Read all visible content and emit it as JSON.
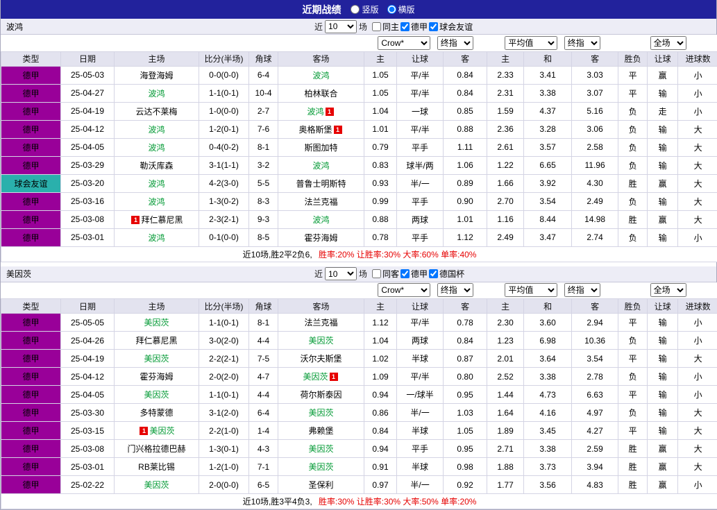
{
  "topbar": {
    "title": "近期战绩",
    "modes": [
      {
        "label": "竖版",
        "selected": false
      },
      {
        "label": "横版",
        "selected": true
      }
    ]
  },
  "headers": [
    "类型",
    "日期",
    "主场",
    "比分(半场)",
    "角球",
    "客场",
    "主",
    "让球",
    "客",
    "主",
    "和",
    "客",
    "胜负",
    "让球",
    "进球数"
  ],
  "select_row": {
    "asia": [
      "Crow*",
      "终指"
    ],
    "euro": [
      "平均值",
      "终指"
    ],
    "scope": [
      "全场"
    ]
  },
  "colors": {
    "topbar": "#22229c",
    "league_badge": "#990099",
    "friendly_badge": "#2ab0ac",
    "win": "#e60000",
    "draw": "#009933",
    "loss": "#1a1ad9",
    "team_highlight": "#009933",
    "score": "#d10000"
  },
  "sections": [
    {
      "team": "波鸿",
      "filters": {
        "recent_label": "近",
        "recent_value": "10",
        "recent_suffix": "场",
        "checkboxes": [
          {
            "label": "同主",
            "checked": false
          },
          {
            "label": "德甲",
            "checked": true
          },
          {
            "label": "球会友谊",
            "checked": true
          }
        ]
      },
      "rows": [
        {
          "type": "德甲",
          "style": "purple",
          "date": "25-05-03",
          "home": {
            "name": "海登海姆",
            "green": false
          },
          "score": "0-0(0-0)",
          "corner": "6-4",
          "away": {
            "name": "波鸿",
            "green": true
          },
          "asia": [
            "1.05",
            "平/半",
            "0.84"
          ],
          "euro": [
            "2.33",
            "3.41",
            "3.03"
          ],
          "res": [
            "平",
            "green"
          ],
          "let": [
            "赢",
            "red"
          ],
          "goal": [
            "小",
            "green"
          ]
        },
        {
          "type": "德甲",
          "style": "purple",
          "date": "25-04-27",
          "home": {
            "name": "波鸿",
            "green": true
          },
          "score": "1-1(0-1)",
          "corner": "10-4",
          "away": {
            "name": "柏林联合",
            "green": false
          },
          "asia": [
            "1.05",
            "平/半",
            "0.84"
          ],
          "euro": [
            "2.31",
            "3.38",
            "3.07"
          ],
          "res": [
            "平",
            "green"
          ],
          "let": [
            "输",
            "blue"
          ],
          "goal": [
            "小",
            "green"
          ]
        },
        {
          "type": "德甲",
          "style": "purple",
          "date": "25-04-19",
          "home": {
            "name": "云达不莱梅",
            "green": false
          },
          "score": "1-0(0-0)",
          "corner": "2-7",
          "away": {
            "name": "波鸿",
            "green": true,
            "card": "after"
          },
          "asia": [
            "1.04",
            "一球",
            "0.85"
          ],
          "euro": [
            "1.59",
            "4.37",
            "5.16"
          ],
          "res": [
            "负",
            "blue"
          ],
          "let": [
            "走",
            "green"
          ],
          "goal": [
            "小",
            "green"
          ]
        },
        {
          "type": "德甲",
          "style": "purple",
          "date": "25-04-12",
          "home": {
            "name": "波鸿",
            "green": true
          },
          "score": "1-2(0-1)",
          "corner": "7-6",
          "away": {
            "name": "奥格斯堡",
            "green": false,
            "card": "after"
          },
          "asia": [
            "1.01",
            "平/半",
            "0.88"
          ],
          "euro": [
            "2.36",
            "3.28",
            "3.06"
          ],
          "res": [
            "负",
            "blue"
          ],
          "let": [
            "输",
            "blue"
          ],
          "goal": [
            "大",
            "red"
          ]
        },
        {
          "type": "德甲",
          "style": "purple",
          "date": "25-04-05",
          "home": {
            "name": "波鸿",
            "green": true
          },
          "score": "0-4(0-2)",
          "corner": "8-1",
          "away": {
            "name": "斯图加特",
            "green": false
          },
          "asia": [
            "0.79",
            "平手",
            "1.11"
          ],
          "euro": [
            "2.61",
            "3.57",
            "2.58"
          ],
          "res": [
            "负",
            "blue"
          ],
          "let": [
            "输",
            "blue"
          ],
          "goal": [
            "大",
            "red"
          ]
        },
        {
          "type": "德甲",
          "style": "purple",
          "date": "25-03-29",
          "home": {
            "name": "勒沃库森",
            "green": false
          },
          "score": "3-1(1-1)",
          "corner": "3-2",
          "away": {
            "name": "波鸿",
            "green": true
          },
          "asia": [
            "0.83",
            "球半/两",
            "1.06"
          ],
          "euro": [
            "1.22",
            "6.65",
            "11.96"
          ],
          "res": [
            "负",
            "blue"
          ],
          "let": [
            "输",
            "blue"
          ],
          "goal": [
            "大",
            "red"
          ]
        },
        {
          "type": "球会友谊",
          "style": "teal",
          "date": "25-03-20",
          "home": {
            "name": "波鸿",
            "green": true
          },
          "score": "4-2(3-0)",
          "corner": "5-5",
          "away": {
            "name": "普鲁士明斯特",
            "green": false
          },
          "asia": [
            "0.93",
            "半/一",
            "0.89"
          ],
          "euro": [
            "1.66",
            "3.92",
            "4.30"
          ],
          "res": [
            "胜",
            "red"
          ],
          "let": [
            "赢",
            "red"
          ],
          "goal": [
            "大",
            "red"
          ]
        },
        {
          "type": "德甲",
          "style": "purple",
          "date": "25-03-16",
          "home": {
            "name": "波鸿",
            "green": true
          },
          "score": "1-3(0-2)",
          "corner": "8-3",
          "away": {
            "name": "法兰克福",
            "green": false
          },
          "asia": [
            "0.99",
            "平手",
            "0.90"
          ],
          "euro": [
            "2.70",
            "3.54",
            "2.49"
          ],
          "res": [
            "负",
            "blue"
          ],
          "let": [
            "输",
            "blue"
          ],
          "goal": [
            "大",
            "red"
          ]
        },
        {
          "type": "德甲",
          "style": "purple",
          "date": "25-03-08",
          "home": {
            "name": "拜仁慕尼黑",
            "green": false,
            "card": "before"
          },
          "score": "2-3(2-1)",
          "corner": "9-3",
          "away": {
            "name": "波鸿",
            "green": true
          },
          "asia": [
            "0.88",
            "两球",
            "1.01"
          ],
          "euro": [
            "1.16",
            "8.44",
            "14.98"
          ],
          "res": [
            "胜",
            "red"
          ],
          "let": [
            "赢",
            "red"
          ],
          "goal": [
            "大",
            "red"
          ]
        },
        {
          "type": "德甲",
          "style": "purple",
          "date": "25-03-01",
          "home": {
            "name": "波鸿",
            "green": true
          },
          "score": "0-1(0-0)",
          "corner": "8-5",
          "away": {
            "name": "霍芬海姆",
            "green": false
          },
          "asia": [
            "0.78",
            "平手",
            "1.12"
          ],
          "euro": [
            "2.49",
            "3.47",
            "2.74"
          ],
          "res": [
            "负",
            "blue"
          ],
          "let": [
            "输",
            "blue"
          ],
          "goal": [
            "小",
            "green"
          ]
        }
      ],
      "footer": {
        "prefix": "近10场,胜2平2负6,",
        "stats": "胜率:20% 让胜率:30% 大率:60% 单率:40%"
      }
    },
    {
      "team": "美因茨",
      "filters": {
        "recent_label": "近",
        "recent_value": "10",
        "recent_suffix": "场",
        "checkboxes": [
          {
            "label": "同客",
            "checked": false
          },
          {
            "label": "德甲",
            "checked": true
          },
          {
            "label": "德国杯",
            "checked": true
          }
        ]
      },
      "rows": [
        {
          "type": "德甲",
          "style": "purple",
          "date": "25-05-05",
          "home": {
            "name": "美因茨",
            "green": true
          },
          "score": "1-1(0-1)",
          "corner": "8-1",
          "away": {
            "name": "法兰克福",
            "green": false
          },
          "asia": [
            "1.12",
            "平/半",
            "0.78"
          ],
          "euro": [
            "2.30",
            "3.60",
            "2.94"
          ],
          "res": [
            "平",
            "green"
          ],
          "let": [
            "输",
            "blue"
          ],
          "goal": [
            "小",
            "green"
          ]
        },
        {
          "type": "德甲",
          "style": "purple",
          "date": "25-04-26",
          "home": {
            "name": "拜仁慕尼黑",
            "green": false
          },
          "score": "3-0(2-0)",
          "corner": "4-4",
          "away": {
            "name": "美因茨",
            "green": true
          },
          "asia": [
            "1.04",
            "两球",
            "0.84"
          ],
          "euro": [
            "1.23",
            "6.98",
            "10.36"
          ],
          "res": [
            "负",
            "blue"
          ],
          "let": [
            "输",
            "blue"
          ],
          "goal": [
            "小",
            "green"
          ]
        },
        {
          "type": "德甲",
          "style": "purple",
          "date": "25-04-19",
          "home": {
            "name": "美因茨",
            "green": true
          },
          "score": "2-2(2-1)",
          "corner": "7-5",
          "away": {
            "name": "沃尔夫斯堡",
            "green": false
          },
          "asia": [
            "1.02",
            "半球",
            "0.87"
          ],
          "euro": [
            "2.01",
            "3.64",
            "3.54"
          ],
          "res": [
            "平",
            "green"
          ],
          "let": [
            "输",
            "blue"
          ],
          "goal": [
            "大",
            "red"
          ]
        },
        {
          "type": "德甲",
          "style": "purple",
          "date": "25-04-12",
          "home": {
            "name": "霍芬海姆",
            "green": false
          },
          "score": "2-0(2-0)",
          "corner": "4-7",
          "away": {
            "name": "美因茨",
            "green": true,
            "card": "after"
          },
          "asia": [
            "1.09",
            "平/半",
            "0.80"
          ],
          "euro": [
            "2.52",
            "3.38",
            "2.78"
          ],
          "res": [
            "负",
            "blue"
          ],
          "let": [
            "输",
            "blue"
          ],
          "goal": [
            "小",
            "green"
          ]
        },
        {
          "type": "德甲",
          "style": "purple",
          "date": "25-04-05",
          "home": {
            "name": "美因茨",
            "green": true
          },
          "score": "1-1(0-1)",
          "corner": "4-4",
          "away": {
            "name": "荷尔斯泰因",
            "green": false
          },
          "asia": [
            "0.94",
            "一/球半",
            "0.95"
          ],
          "euro": [
            "1.44",
            "4.73",
            "6.63"
          ],
          "res": [
            "平",
            "green"
          ],
          "let": [
            "输",
            "blue"
          ],
          "goal": [
            "小",
            "green"
          ]
        },
        {
          "type": "德甲",
          "style": "purple",
          "date": "25-03-30",
          "home": {
            "name": "多特蒙德",
            "green": false
          },
          "score": "3-1(2-0)",
          "corner": "6-4",
          "away": {
            "name": "美因茨",
            "green": true
          },
          "asia": [
            "0.86",
            "半/一",
            "1.03"
          ],
          "euro": [
            "1.64",
            "4.16",
            "4.97"
          ],
          "res": [
            "负",
            "blue"
          ],
          "let": [
            "输",
            "blue"
          ],
          "goal": [
            "大",
            "red"
          ]
        },
        {
          "type": "德甲",
          "style": "purple",
          "date": "25-03-15",
          "home": {
            "name": "美因茨",
            "green": true,
            "card": "before"
          },
          "score": "2-2(1-0)",
          "corner": "1-4",
          "away": {
            "name": "弗赖堡",
            "green": false
          },
          "asia": [
            "0.84",
            "半球",
            "1.05"
          ],
          "euro": [
            "1.89",
            "3.45",
            "4.27"
          ],
          "res": [
            "平",
            "green"
          ],
          "let": [
            "输",
            "blue"
          ],
          "goal": [
            "大",
            "red"
          ]
        },
        {
          "type": "德甲",
          "style": "purple",
          "date": "25-03-08",
          "home": {
            "name": "门兴格拉德巴赫",
            "green": false
          },
          "score": "1-3(0-1)",
          "corner": "4-3",
          "away": {
            "name": "美因茨",
            "green": true
          },
          "asia": [
            "0.94",
            "平手",
            "0.95"
          ],
          "euro": [
            "2.71",
            "3.38",
            "2.59"
          ],
          "res": [
            "胜",
            "red"
          ],
          "let": [
            "赢",
            "red"
          ],
          "goal": [
            "大",
            "red"
          ]
        },
        {
          "type": "德甲",
          "style": "purple",
          "date": "25-03-01",
          "home": {
            "name": "RB莱比锡",
            "green": false
          },
          "score": "1-2(1-0)",
          "corner": "7-1",
          "away": {
            "name": "美因茨",
            "green": true
          },
          "asia": [
            "0.91",
            "半球",
            "0.98"
          ],
          "euro": [
            "1.88",
            "3.73",
            "3.94"
          ],
          "res": [
            "胜",
            "red"
          ],
          "let": [
            "赢",
            "red"
          ],
          "goal": [
            "大",
            "red"
          ]
        },
        {
          "type": "德甲",
          "style": "purple",
          "date": "25-02-22",
          "home": {
            "name": "美因茨",
            "green": true
          },
          "score": "2-0(0-0)",
          "corner": "6-5",
          "away": {
            "name": "圣保利",
            "green": false
          },
          "asia": [
            "0.97",
            "半/一",
            "0.92"
          ],
          "euro": [
            "1.77",
            "3.56",
            "4.83"
          ],
          "res": [
            "胜",
            "red"
          ],
          "let": [
            "赢",
            "red"
          ],
          "goal": [
            "小",
            "green"
          ]
        }
      ],
      "footer": {
        "prefix": "近10场,胜3平4负3,",
        "stats": "胜率:30% 让胜率:30% 大率:50% 单率:20%"
      }
    }
  ]
}
